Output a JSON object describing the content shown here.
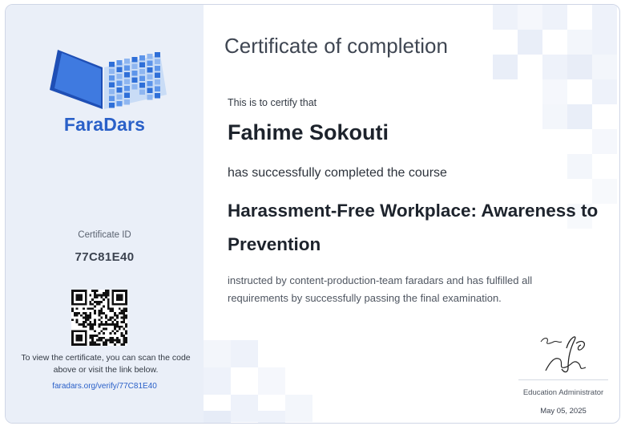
{
  "brand": {
    "name": "FaraDars",
    "colors": {
      "primary": "#2a60c8",
      "sidebar_bg": "#eaeff8"
    }
  },
  "certificate": {
    "title": "Certificate of completion",
    "certify_line": "This is to certify that",
    "recipient": "Fahime Sokouti",
    "completed_line": "has successfully completed the course",
    "course": "Harassment-Free Workplace: Awareness to Prevention",
    "instructed_line": "instructed by content-production-team faradars and has fulfilled all requirements by successfully passing the final examination.",
    "signatory_role": "Education Administrator",
    "date": "May 05, 2025"
  },
  "sidebar": {
    "id_label": "Certificate ID",
    "id_value": "77C81E40",
    "scan_text": "To view the certificate, you can scan the code above or visit the link below.",
    "verify_link": "faradars.org/verify/77C81E40"
  },
  "icons": {
    "logo": "open-book-logo-icon",
    "qr": "qr-code-icon",
    "signature": "handwritten-signature"
  }
}
